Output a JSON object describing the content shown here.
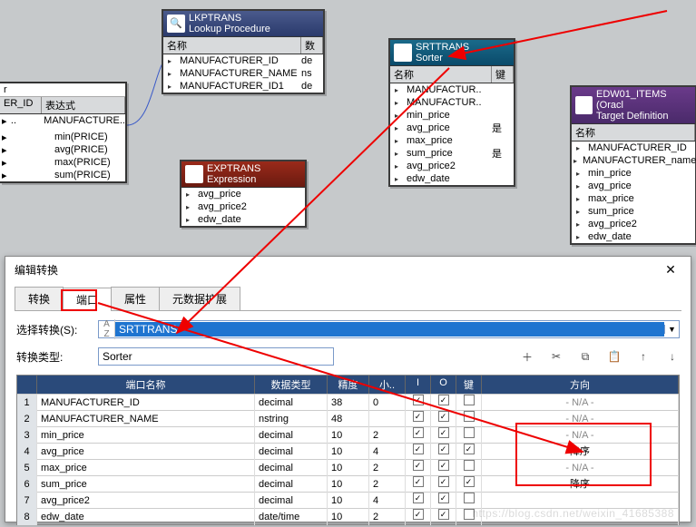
{
  "canvas": {
    "lookup": {
      "title1": "LKPTRANS",
      "title2": "Lookup Procedure",
      "header_name": "名称",
      "header_type": "数",
      "rows": [
        {
          "name": "MANUFACTURER_ID",
          "t": "de"
        },
        {
          "name": "MANUFACTURER_NAME",
          "t": "ns"
        },
        {
          "name": "MANUFACTURER_ID1",
          "t": "de"
        }
      ]
    },
    "sorter": {
      "title1": "SRTTRANS",
      "title2": "Sorter",
      "header_name": "名称",
      "header_key": "键",
      "rows": [
        {
          "name": "MANUFACTUR..",
          "key": ""
        },
        {
          "name": "MANUFACTUR..",
          "key": ""
        },
        {
          "name": "min_price",
          "key": ""
        },
        {
          "name": "avg_price",
          "key": "是"
        },
        {
          "name": "max_price",
          "key": ""
        },
        {
          "name": "sum_price",
          "key": "是"
        },
        {
          "name": "avg_price2",
          "key": ""
        },
        {
          "name": "edw_date",
          "key": ""
        }
      ]
    },
    "expression": {
      "title1": "EXPTRANS",
      "title2": "Expression",
      "rows": [
        {
          "name": "avg_price"
        },
        {
          "name": "avg_price2"
        },
        {
          "name": "edw_date"
        }
      ]
    },
    "target": {
      "title1": "EDW01_ITEMS (Oracl",
      "title2": "Target Definition",
      "header_name": "名称",
      "rows": [
        {
          "name": "MANUFACTURER_ID"
        },
        {
          "name": "MANUFACTURER_name"
        },
        {
          "name": "min_price"
        },
        {
          "name": "avg_price"
        },
        {
          "name": "max_price"
        },
        {
          "name": "sum_price"
        },
        {
          "name": "avg_price2"
        },
        {
          "name": "edw_date"
        }
      ]
    },
    "leftsrc": {
      "h1": "ER_ID",
      "h2": "表达式",
      "row0": "MANUFACTURE..",
      "rows": [
        {
          "name": "min(PRICE)"
        },
        {
          "name": "avg(PRICE)"
        },
        {
          "name": "max(PRICE)"
        },
        {
          "name": "sum(PRICE)"
        }
      ]
    }
  },
  "dialog": {
    "title": "编辑转换",
    "tabs": [
      "转换",
      "端口",
      "属性",
      "元数据扩展"
    ],
    "select_label": "选择转换(S):",
    "select_value": "SRTTRANS",
    "type_label": "转换类型:",
    "type_value": "Sorter",
    "grid_headers": {
      "port": "端口名称",
      "dtype": "数据类型",
      "prec": "精度",
      "scale": "小..",
      "i": "I",
      "o": "O",
      "key": "键",
      "dir": "方向"
    },
    "grid_rows": [
      {
        "n": "1",
        "name": "MANUFACTURER_ID",
        "dt": "decimal",
        "p": "38",
        "s": "0",
        "i": true,
        "o": true,
        "k": false,
        "dir": "- N/A -",
        "active": false
      },
      {
        "n": "2",
        "name": "MANUFACTURER_NAME",
        "dt": "nstring",
        "p": "48",
        "s": "",
        "i": true,
        "o": true,
        "k": false,
        "dir": "- N/A -",
        "active": false
      },
      {
        "n": "3",
        "name": "min_price",
        "dt": "decimal",
        "p": "10",
        "s": "2",
        "i": true,
        "o": true,
        "k": false,
        "dir": "- N/A -",
        "active": false
      },
      {
        "n": "4",
        "name": "avg_price",
        "dt": "decimal",
        "p": "10",
        "s": "4",
        "i": true,
        "o": true,
        "k": true,
        "dir": "降序",
        "active": true
      },
      {
        "n": "5",
        "name": "max_price",
        "dt": "decimal",
        "p": "10",
        "s": "2",
        "i": true,
        "o": true,
        "k": false,
        "dir": "- N/A -",
        "active": false
      },
      {
        "n": "6",
        "name": "sum_price",
        "dt": "decimal",
        "p": "10",
        "s": "2",
        "i": true,
        "o": true,
        "k": true,
        "dir": "降序",
        "active": true
      },
      {
        "n": "7",
        "name": "avg_price2",
        "dt": "decimal",
        "p": "10",
        "s": "4",
        "i": true,
        "o": true,
        "k": false,
        "dir": "",
        "active": false
      },
      {
        "n": "8",
        "name": "edw_date",
        "dt": "date/time",
        "p": "10",
        "s": "2",
        "i": true,
        "o": true,
        "k": false,
        "dir": "",
        "active": false
      }
    ]
  },
  "watermark": "https://blog.csdn.net/weixin_41685388"
}
